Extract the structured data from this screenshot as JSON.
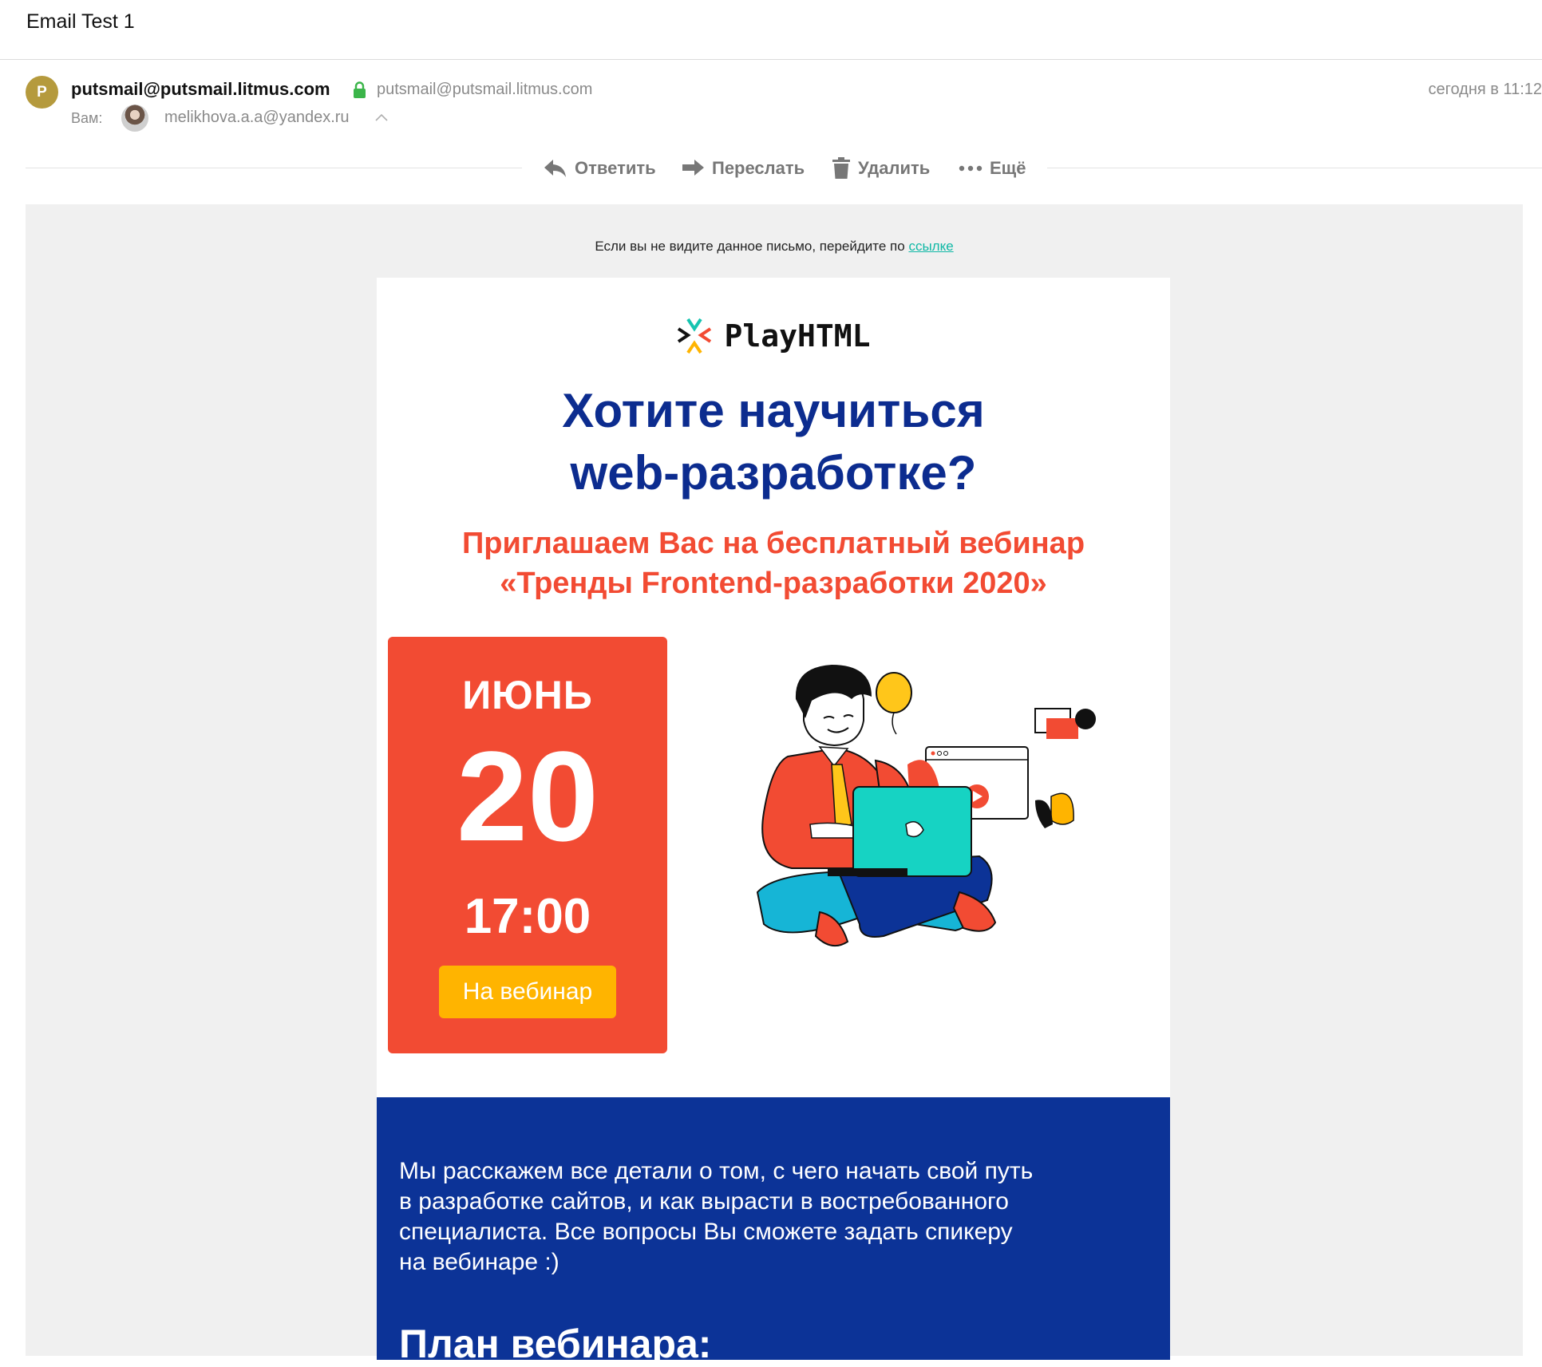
{
  "subject": "Email Test 1",
  "sender": {
    "avatar_letter": "P",
    "name": "putsmail@putsmail.litmus.com",
    "address": "putsmail@putsmail.litmus.com",
    "date": "сегодня в 11:12"
  },
  "recipients": {
    "to_label": "Вам:",
    "address": "melikhova.a.a@yandex.ru"
  },
  "toolbar": {
    "reply": "Ответить",
    "forward": "Переслать",
    "delete": "Удалить",
    "more": "Ещё"
  },
  "email": {
    "preheader_text": "Если вы не видите данное письмо, перейдите по ",
    "preheader_link": "ссылке",
    "logo_text": "PlayHTML",
    "headline": [
      "Хотите научиться",
      "web-разработке?"
    ],
    "subheadline": [
      "Приглашаем Вас на бесплатный вебинар",
      "«Тренды Frontend-разработки 2020»"
    ],
    "date_card": {
      "month": "ИЮНЬ",
      "day": "20",
      "time": "17:00",
      "button": "На вебинар"
    },
    "description": [
      "Мы расскажем все детали о том, с чего начать свой путь",
      "в разработке сайтов, и как вырасти в востребованного",
      "специалиста. Все вопросы Вы сможете задать спикеру",
      "на вебинаре :)"
    ],
    "plan_heading": "План вебинара:"
  },
  "colors": {
    "brand_blue": "#0c2c8f",
    "section_blue": "#0c3397",
    "accent_red": "#f24b33",
    "button_yellow": "#ffb400",
    "link_teal": "#0fb8a5"
  }
}
